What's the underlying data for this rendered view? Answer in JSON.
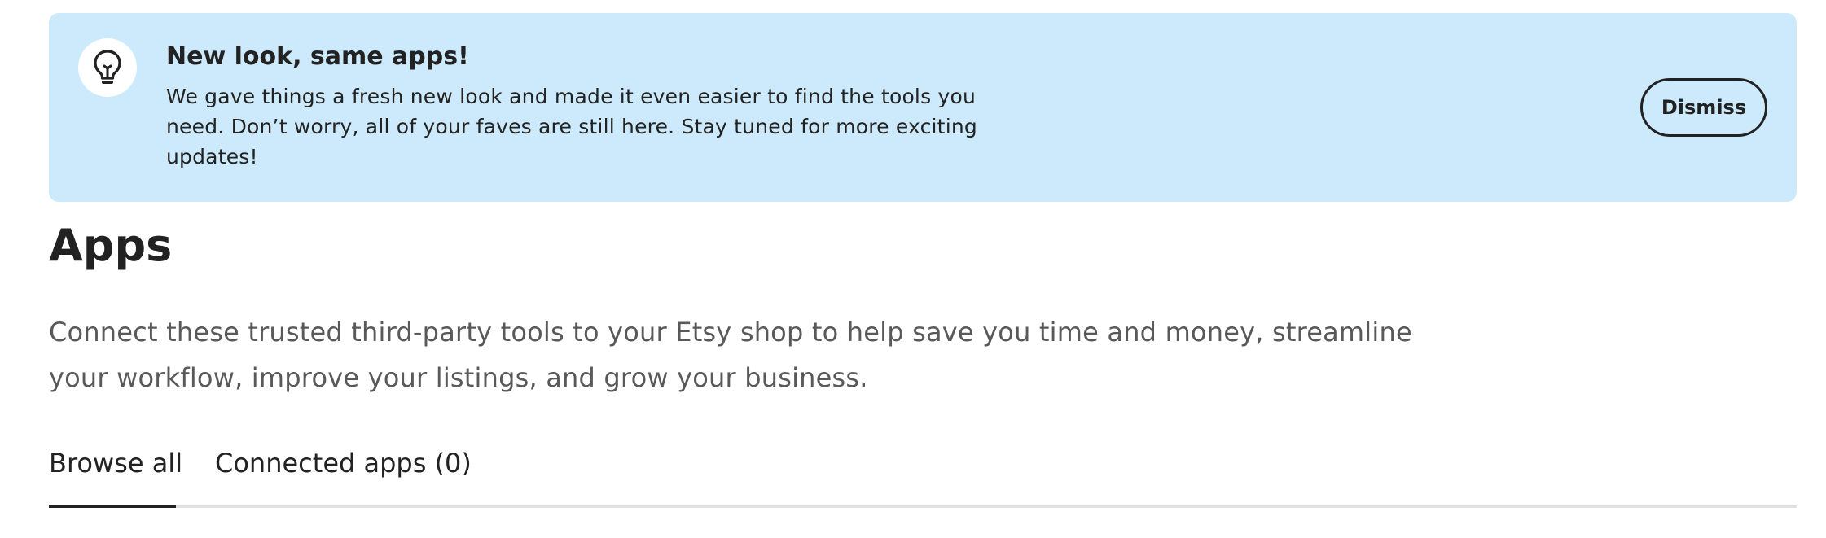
{
  "banner": {
    "icon": "lightbulb-icon",
    "title": "New look, same apps!",
    "body": "We gave things a fresh new look and made it even easier to find the tools you need. Don’t worry, all of your faves are still here. Stay tuned for more exciting updates!",
    "dismiss_label": "Dismiss",
    "background_color": "#cceafb"
  },
  "page": {
    "title": "Apps",
    "description": "Connect these trusted third-party tools to your Etsy shop to help save you time and money, streamline your workflow, improve your listings, and grow your business."
  },
  "tabs": [
    {
      "label": "Browse all",
      "active": true
    },
    {
      "label": "Connected apps (0)",
      "active": false
    }
  ]
}
